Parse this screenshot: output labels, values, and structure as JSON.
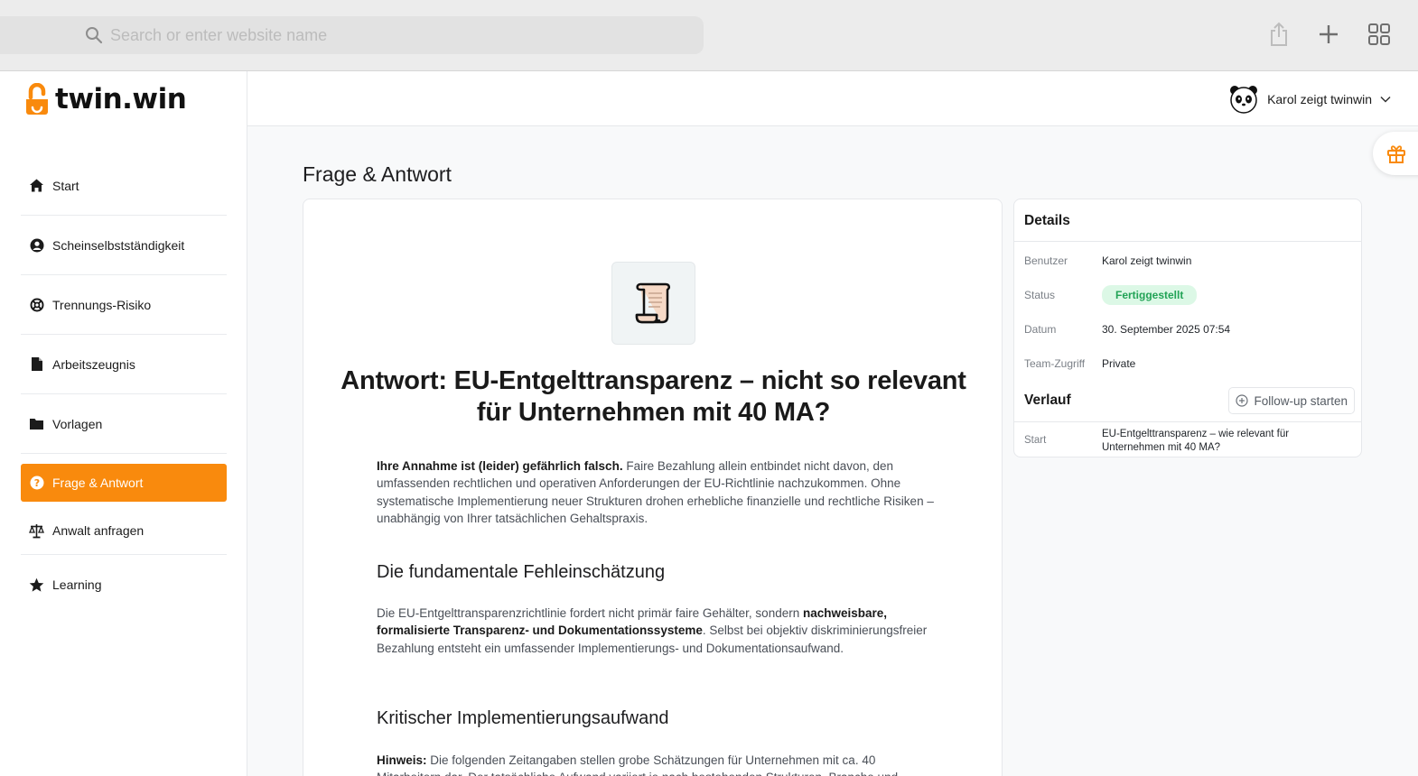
{
  "browser": {
    "search_placeholder": "Search or enter website name"
  },
  "brand": {
    "logo_text": "twin.win",
    "accent": "#f98a0d"
  },
  "sidebar": {
    "items": [
      {
        "label": "Start",
        "icon": "home-icon"
      },
      {
        "label": "Scheinselbstständigkeit",
        "icon": "user-circle-icon"
      },
      {
        "label": "Trennungs-Risiko",
        "icon": "lifebuoy-icon"
      },
      {
        "label": "Arbeitszeugnis",
        "icon": "document-icon"
      },
      {
        "label": "Vorlagen",
        "icon": "folder-icon"
      },
      {
        "label": "Frage & Antwort",
        "icon": "question-circle-icon",
        "active": true
      },
      {
        "label": "Anwalt anfragen",
        "icon": "scales-icon"
      },
      {
        "label": "Learning",
        "icon": "star-icon"
      }
    ]
  },
  "header": {
    "user_name": "Karol zeigt twinwin"
  },
  "page": {
    "title": "Frage & Antwort"
  },
  "answer": {
    "icon": "scroll-icon",
    "title": "Antwort: EU-Entgelttransparenz – nicht so relevant für Unternehmen mit 40 MA?",
    "p1_bold": "Ihre Annahme ist (leider) gefährlich falsch.",
    "p1_text": " Faire Bezahlung allein entbindet nicht davon, den umfassenden rechtlichen und operativen Anforderungen der EU-Richtlinie nachzukommen. Ohne systematische Implementierung neuer Strukturen drohen erhebliche finanzielle und rechtliche Risiken – unabhängig von Ihrer tatsächlichen Gehaltspraxis.",
    "h2_1": "Die fundamentale Fehleinschätzung",
    "p2_text_a": "Die EU-Entgelttransparenzrichtlinie fordert nicht primär faire Gehälter, sondern ",
    "p2_bold": "nachweisbare, formalisierte Transparenz- und Dokumentationssysteme",
    "p2_text_b": ". Selbst bei objektiv diskriminierungsfreier Bezahlung entsteht ein umfassender Implementierungs- und Dokumentationsaufwand.",
    "h2_2": "Kritischer Implementierungsaufwand",
    "p3_bold": "Hinweis:",
    "p3_text": " Die folgenden Zeitangaben stellen grobe Schätzungen für Unternehmen mit ca. 40 Mitarbeitern dar. Der tatsächliche Aufwand variiert je nach bestehenden Strukturen, Branche und"
  },
  "details": {
    "title": "Details",
    "rows": [
      {
        "key": "Benutzer",
        "value": "Karol zeigt twinwin"
      },
      {
        "key": "Status",
        "value": "Fertiggestellt"
      },
      {
        "key": "Datum",
        "value": "30. September 2025 07:54"
      },
      {
        "key": "Team-Zugriff",
        "value": "Private"
      }
    ],
    "status_color": "#22a356",
    "verlauf_title": "Verlauf",
    "followup_label": "Follow-up starten",
    "verlauf_rows": [
      {
        "key": "Start",
        "value": "EU-Entgelttransparenz – wie relevant für Unternehmen mit 40 MA?"
      }
    ]
  }
}
